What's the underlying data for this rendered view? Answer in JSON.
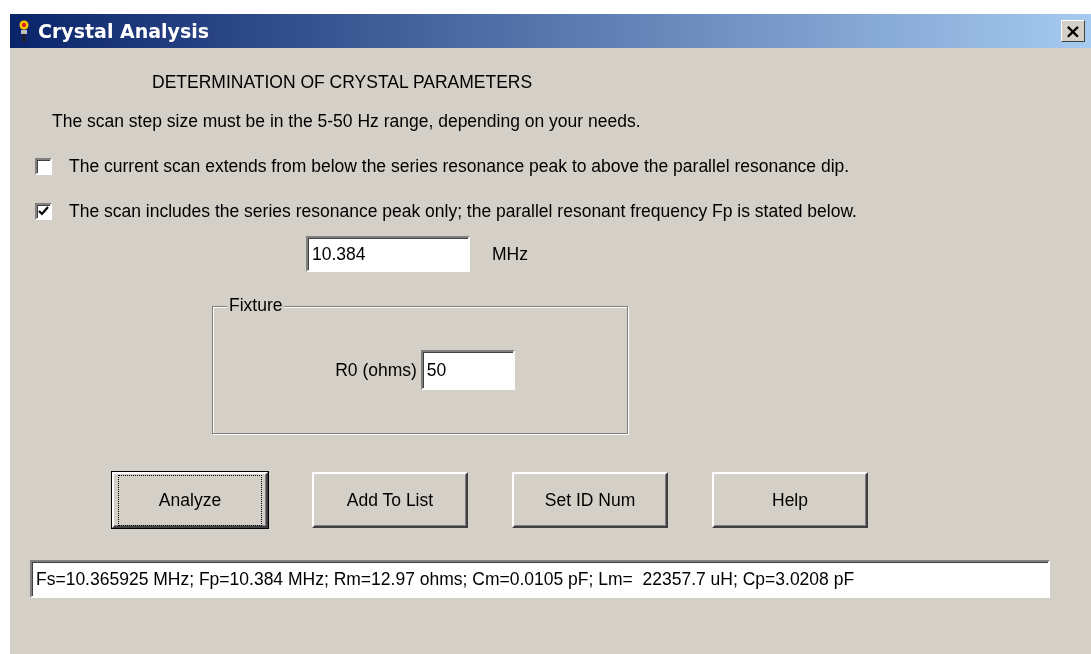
{
  "window": {
    "title": "Crystal Analysis",
    "close_label": "×"
  },
  "heading": "DETERMINATION OF CRYSTAL PARAMETERS",
  "note": "The scan step size must be in the 5-50 Hz range, depending on your needs.",
  "options": [
    {
      "label": "The current scan extends from below the series resonance peak to above the parallel resonance dip.",
      "checked": false
    },
    {
      "label": "The scan includes the series resonance peak only; the parallel resonant frequency Fp is stated below.",
      "checked": true
    }
  ],
  "fp_field": {
    "value": "10.384",
    "unit": "MHz"
  },
  "fixture": {
    "title": "Fixture",
    "label": "R0 (ohms)",
    "value": "50"
  },
  "buttons": [
    {
      "label": "Analyze",
      "default": true
    },
    {
      "label": "Add To List",
      "default": false
    },
    {
      "label": "Set ID Num",
      "default": false
    },
    {
      "label": "Help",
      "default": false
    }
  ],
  "result": "Fs=10.365925 MHz; Fp=10.384 MHz; Rm=12.97 ohms; Cm=0.0105 pF; Lm=  22357.7 uH; Cp=3.0208 pF"
}
